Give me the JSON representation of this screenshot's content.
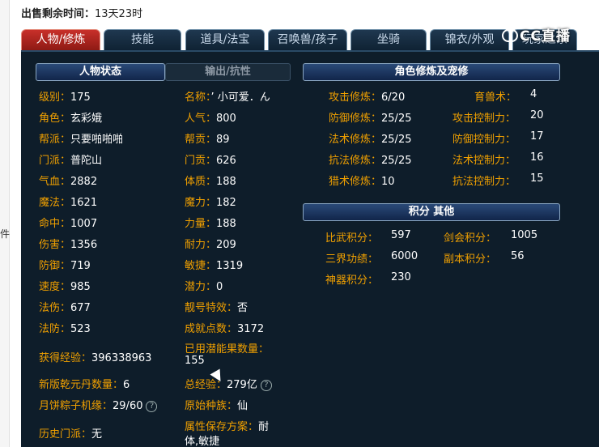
{
  "sale": {
    "label": "出售剩余时间：",
    "value": "13天23时"
  },
  "page_fragment": "件",
  "tabs": [
    "人物/修炼",
    "技能",
    "道具/法宝",
    "召唤兽/孩子",
    "坐骑",
    "锦衣/外观",
    "玩家之家"
  ],
  "logo": {
    "text": "CC直播"
  },
  "status_tabs": {
    "active": "人物状态",
    "inactive": "输出/抗性"
  },
  "left_col": [
    {
      "label": "级别：",
      "value": "175"
    },
    {
      "label": "角色：",
      "value": "玄彩娥"
    },
    {
      "label": "帮派：",
      "value": "只要啪啪啪"
    },
    {
      "label": "门派：",
      "value": "普陀山"
    },
    {
      "label": "气血：",
      "value": "2882"
    },
    {
      "label": "魔法：",
      "value": "1621"
    },
    {
      "label": "命中：",
      "value": "1007"
    },
    {
      "label": "伤害：",
      "value": "1356"
    },
    {
      "label": "防御：",
      "value": "719"
    },
    {
      "label": "速度：",
      "value": "985"
    },
    {
      "label": "法伤：",
      "value": "677"
    },
    {
      "label": "法防：",
      "value": "523"
    }
  ],
  "mid_col": [
    {
      "label": "名称：",
      "value": "’ 小可爱．ん"
    },
    {
      "label": "人气：",
      "value": "800"
    },
    {
      "label": "帮贡：",
      "value": "89"
    },
    {
      "label": "门贡：",
      "value": "626"
    },
    {
      "label": "体质：",
      "value": "188"
    },
    {
      "label": "魔力：",
      "value": "182"
    },
    {
      "label": "力量：",
      "value": "188"
    },
    {
      "label": "耐力：",
      "value": "209"
    },
    {
      "label": "敏捷：",
      "value": "1319"
    },
    {
      "label": "潜力：",
      "value": "0"
    },
    {
      "label": "靓号特效：",
      "value": "否"
    },
    {
      "label": "成就点数：",
      "value": "3172"
    }
  ],
  "extra": {
    "exp": {
      "label": "获得经验：",
      "value": "396338963"
    },
    "potion": {
      "label": "已用潜能果数量：",
      "value": "155"
    },
    "qiankun": {
      "label": "新版乾元丹数量：",
      "value": "6"
    },
    "total_exp": {
      "label": "总经验：",
      "value": "279亿"
    },
    "zongzi": {
      "label": "月饼粽子机缘：",
      "value": "29/60"
    },
    "race": {
      "label": "原始种族：",
      "value": "仙"
    },
    "history": {
      "label": "历史门派：",
      "value": "无"
    },
    "attr_plan": {
      "label": "属性保存方案：",
      "value_line1": "耐",
      "value_line2": "体,敏捷"
    }
  },
  "cultivation": {
    "title": "角色修炼及宠修",
    "rows": [
      {
        "l1": "攻击修炼：",
        "v1": "6/20",
        "l2": "育兽术：",
        "v2": "4"
      },
      {
        "l1": "防御修炼：",
        "v1": "25/25",
        "l2": "攻击控制力：",
        "v2": "20"
      },
      {
        "l1": "法术修炼：",
        "v1": "25/25",
        "l2": "防御控制力：",
        "v2": "17"
      },
      {
        "l1": "抗法修炼：",
        "v1": "25/25",
        "l2": "法术控制力：",
        "v2": "16"
      },
      {
        "l1": "猎术修炼：",
        "v1": "10",
        "l2": "抗法控制力：",
        "v2": "15"
      }
    ]
  },
  "points": {
    "title": "积分 其他",
    "rows": [
      {
        "l1": "比武积分：",
        "v1": "597",
        "l2": "剑会积分：",
        "v2": "1005"
      },
      {
        "l1": "三界功绩：",
        "v1": "6000",
        "l2": "副本积分：",
        "v2": "56"
      },
      {
        "l1": "神器积分：",
        "v1": "230",
        "l2": "",
        "v2": ""
      }
    ]
  },
  "icons": {
    "help": "question-circle-icon",
    "cursor": "mouse-cursor-icon",
    "logo": "cc-live-logo-icon"
  },
  "colors": {
    "label": "#f0a000",
    "panel_bg": "#0e1d2a",
    "active_tab": "#c8302a"
  }
}
